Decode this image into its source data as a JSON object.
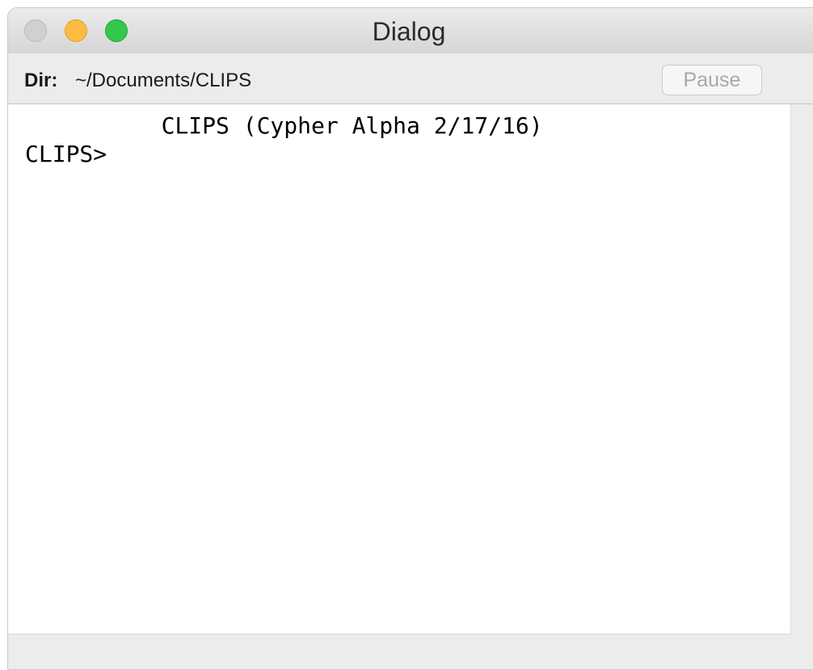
{
  "window": {
    "title": "Dialog"
  },
  "window_controls": {
    "close": "close-icon",
    "minimize": "minimize-icon",
    "zoom": "zoom-icon",
    "colors": {
      "close": "#d0d0d0",
      "minimize": "#fdbc40",
      "zoom": "#34c84a"
    }
  },
  "toolbar": {
    "dir_label": "Dir:",
    "dir_value": "~/Documents/CLIPS",
    "pause_label": "Pause"
  },
  "console": {
    "lines": [
      "          CLIPS (Cypher Alpha 2/17/16)",
      "CLIPS>"
    ]
  }
}
